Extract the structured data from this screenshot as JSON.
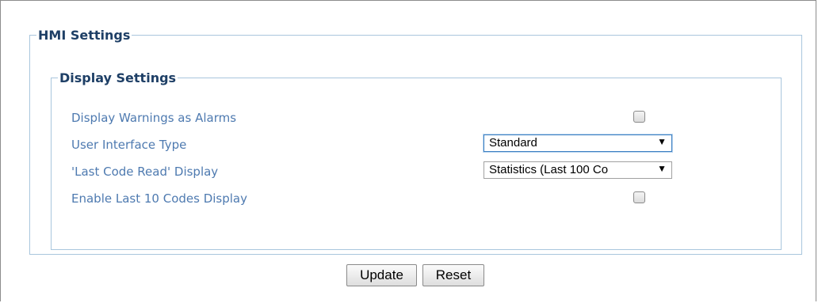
{
  "hmi": {
    "legend": "HMI Settings",
    "display": {
      "legend": "Display Settings",
      "warnings_label": "Display Warnings as Alarms",
      "warnings_checked": false,
      "ui_type_label": "User Interface Type",
      "ui_type_value": "Standard",
      "last_code_label": "'Last Code Read' Display",
      "last_code_value": "Statistics (Last 100 Co",
      "last10_label": "Enable Last 10 Codes Display",
      "last10_checked": false
    }
  },
  "buttons": {
    "update_label": "Update",
    "reset_label": "Reset"
  },
  "icons": {
    "dropdown": "triangle-down-icon"
  }
}
